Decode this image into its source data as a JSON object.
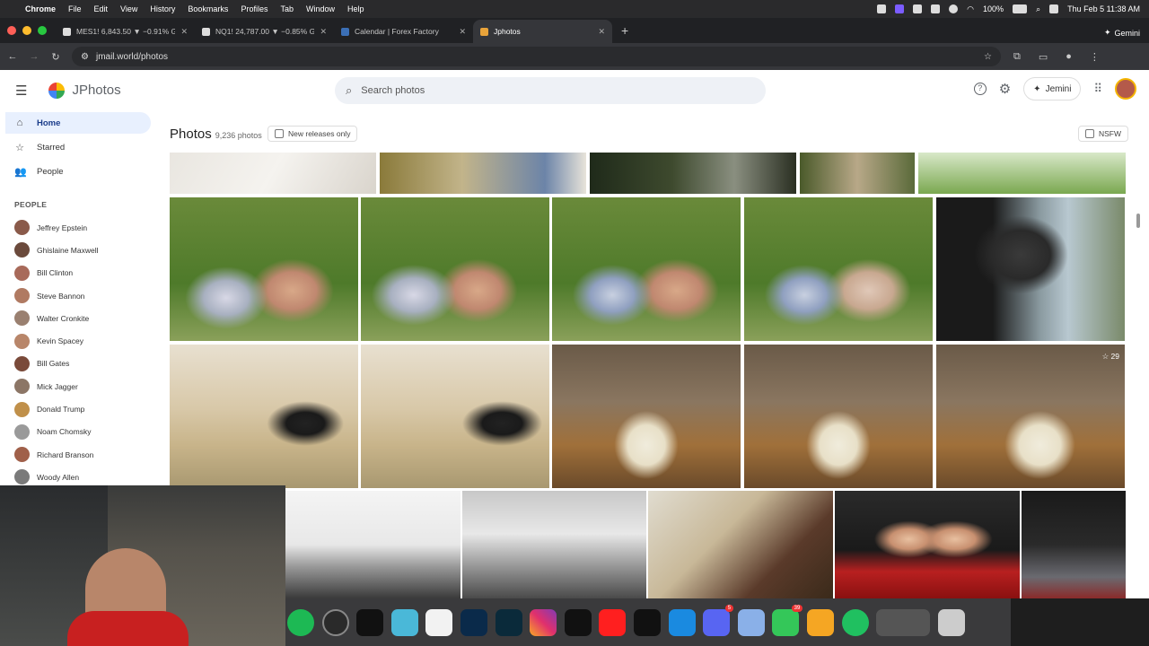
{
  "menubar": {
    "app": "Chrome",
    "menus": [
      "File",
      "Edit",
      "View",
      "History",
      "Bookmarks",
      "Profiles",
      "Tab",
      "Window",
      "Help"
    ],
    "battery": "100%",
    "datetime": "Thu Feb 5  11:38 AM"
  },
  "tabs": [
    {
      "title": "MES1! 6,843.50 ▼ −0.91% G",
      "active": false
    },
    {
      "title": "NQ1! 24,787.00 ▼ −0.85% G",
      "active": false
    },
    {
      "title": "Calendar | Forex Factory",
      "active": false
    },
    {
      "title": "Jphotos",
      "active": true
    }
  ],
  "gemini_label": "Gemini",
  "url": "jmail.world/photos",
  "app": {
    "brand": "JPhotos",
    "search_placeholder": "Search photos",
    "gemini_button": "Jemini"
  },
  "sidebar": {
    "items": [
      {
        "label": "Home",
        "icon": "home-icon",
        "active": true
      },
      {
        "label": "Starred",
        "icon": "star-icon",
        "active": false
      },
      {
        "label": "People",
        "icon": "people-icon",
        "active": false
      }
    ],
    "people_heading": "PEOPLE",
    "people": [
      {
        "name": "Jeffrey Epstein",
        "color": "#8a5a4a"
      },
      {
        "name": "Ghislaine Maxwell",
        "color": "#6b4a3c"
      },
      {
        "name": "Bill Clinton",
        "color": "#a86a5a"
      },
      {
        "name": "Steve Bannon",
        "color": "#b07a62"
      },
      {
        "name": "Walter Cronkite",
        "color": "#9a8070"
      },
      {
        "name": "Kevin Spacey",
        "color": "#b8866a"
      },
      {
        "name": "Bill Gates",
        "color": "#7a4a3a"
      },
      {
        "name": "Mick Jagger",
        "color": "#8c7666"
      },
      {
        "name": "Donald Trump",
        "color": "#c0904a"
      },
      {
        "name": "Noam Chomsky",
        "color": "#9a9a9a"
      },
      {
        "name": "Richard Branson",
        "color": "#a0604a"
      },
      {
        "name": "Woody Allen",
        "color": "#7a7a7a"
      }
    ]
  },
  "main": {
    "title": "Photos",
    "count": "9,236 photos",
    "new_releases_label": "New releases only",
    "nsfw_label": "NSFW",
    "star_badge": "☆ 29"
  },
  "colors": {
    "accent": "#1a73e8",
    "active_nav": "#e8f0fe"
  }
}
